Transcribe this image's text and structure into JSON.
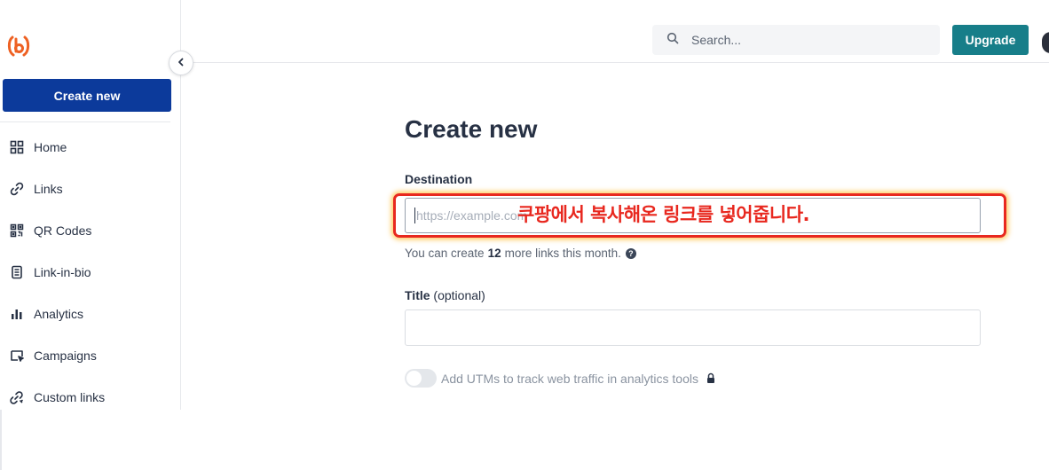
{
  "sidebar": {
    "create_button": "Create new",
    "items": [
      {
        "label": "Home",
        "icon": "grid-icon"
      },
      {
        "label": "Links",
        "icon": "link-icon"
      },
      {
        "label": "QR Codes",
        "icon": "qr-code-icon"
      },
      {
        "label": "Link-in-bio",
        "icon": "page-icon"
      },
      {
        "label": "Analytics",
        "icon": "bar-chart-icon"
      },
      {
        "label": "Campaigns",
        "icon": "campaign-icon"
      },
      {
        "label": "Custom links",
        "icon": "custom-link-icon"
      }
    ]
  },
  "header": {
    "search_label": "Search...",
    "upgrade_label": "Upgrade"
  },
  "main": {
    "title": "Create new",
    "destination_label": "Destination",
    "destination_placeholder": "https://example.com",
    "annotation": "쿠팡에서 복사해온 링크를 넣어줍니다.",
    "quota_prefix": "You can create",
    "quota_count": "12",
    "quota_suffix": "more links this month.",
    "title_label": "Title",
    "title_optional": "(optional)",
    "utm_label": "Add UTMs to track web traffic in analytics tools"
  },
  "colors": {
    "primary": "#0c3a9b",
    "upgrade": "#177e89",
    "brand": "#ee6123",
    "annotation": "#e8281f"
  }
}
